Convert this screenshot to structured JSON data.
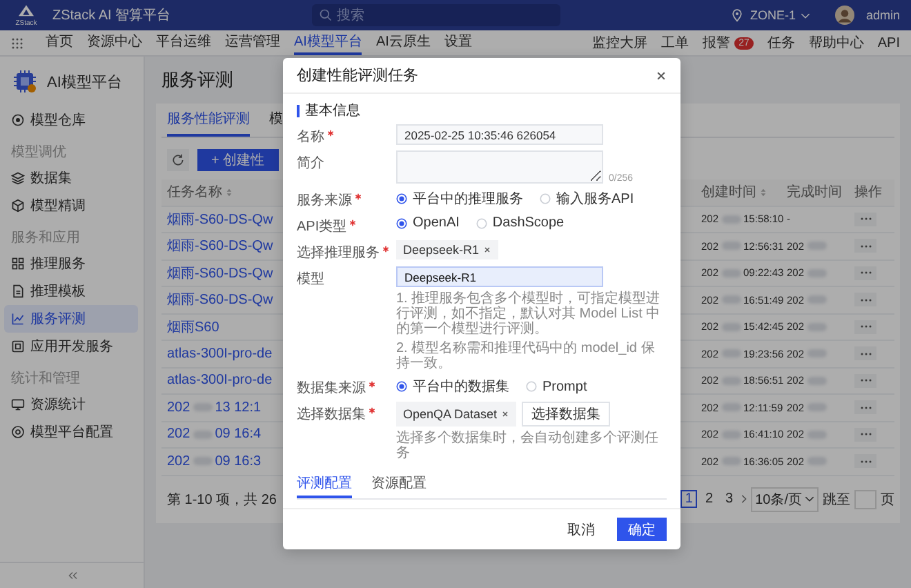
{
  "header": {
    "logo_text": "ZStack",
    "app_name": "ZStack AI 智算平台",
    "search_placeholder": "搜索",
    "zone": "ZONE-1",
    "user": "admin"
  },
  "nav": {
    "items": [
      {
        "label": "首页",
        "selected": false
      },
      {
        "label": "资源中心",
        "selected": false
      },
      {
        "label": "平台运维",
        "selected": false
      },
      {
        "label": "运营管理",
        "selected": false
      },
      {
        "label": "AI模型平台",
        "selected": true
      },
      {
        "label": "AI云原生",
        "selected": false
      },
      {
        "label": "设置",
        "selected": false
      }
    ],
    "right": [
      {
        "label": "监控大屏"
      },
      {
        "label": "工单"
      },
      {
        "label": "报警",
        "badge": "27"
      },
      {
        "label": "任务"
      },
      {
        "label": "帮助中心"
      },
      {
        "label": "API"
      }
    ]
  },
  "sidebar": {
    "title": "AI模型平台",
    "groups": [
      {
        "items": [
          {
            "label": "模型仓库",
            "selected": false
          }
        ]
      },
      {
        "heading": "模型调优",
        "items": [
          {
            "label": "数据集",
            "selected": false
          },
          {
            "label": "模型精调",
            "selected": false
          }
        ]
      },
      {
        "heading": "服务和应用",
        "items": [
          {
            "label": "推理服务",
            "selected": false
          },
          {
            "label": "推理模板",
            "selected": false
          },
          {
            "label": "服务评测",
            "selected": true
          },
          {
            "label": "应用开发服务",
            "selected": false
          }
        ]
      },
      {
        "heading": "统计和管理",
        "items": [
          {
            "label": "资源统计",
            "selected": false
          },
          {
            "label": "模型平台配置",
            "selected": false
          }
        ]
      }
    ]
  },
  "page": {
    "title": "服务评测",
    "tabs": [
      {
        "label": "服务性能评测",
        "selected": true
      },
      {
        "label": "模",
        "selected": false
      }
    ],
    "create_button": "+ 创建性"
  },
  "table": {
    "columns": [
      {
        "label": "任务名称",
        "sortable": true
      },
      {
        "label": "创建时间",
        "sortable": true
      },
      {
        "label": "完成时间",
        "sortable": false
      },
      {
        "label": "操作",
        "sortable": false
      }
    ],
    "rows": [
      {
        "name": "烟雨-S60-DS-Qw",
        "created": "202",
        "created_tail": "15:58:10",
        "completed": "-",
        "completed_redacted": false
      },
      {
        "name": "烟雨-S60-DS-Qw",
        "created": "202",
        "created_tail": "12:56:31",
        "completed": "202",
        "completed_redacted": true
      },
      {
        "name": "烟雨-S60-DS-Qw",
        "created": "202",
        "created_tail": "09:22:43",
        "completed": "202",
        "completed_redacted": true
      },
      {
        "name": "烟雨-S60-DS-Qw",
        "created": "202",
        "created_tail": "16:51:49",
        "completed": "202",
        "completed_redacted": true
      },
      {
        "name": "烟雨S60",
        "created": "202",
        "created_tail": "15:42:45",
        "completed": "202",
        "completed_redacted": true
      },
      {
        "name": "atlas-300I-pro-de",
        "created": "202",
        "created_tail": "19:23:56",
        "completed": "202",
        "completed_redacted": true
      },
      {
        "name": "atlas-300I-pro-de",
        "created": "202",
        "created_tail": "18:56:51",
        "completed": "202",
        "completed_redacted": true
      },
      {
        "name": "202",
        "name_tail": "13 12:1",
        "created": "202",
        "created_tail": "12:11:59",
        "completed": "202",
        "completed_redacted": true
      },
      {
        "name": "202",
        "name_tail": "09 16:4",
        "created": "202",
        "created_tail": "16:41:10",
        "completed": "202",
        "completed_redacted": true
      },
      {
        "name": "202",
        "name_tail": "09 16:3",
        "created": "202",
        "created_tail": "16:36:05",
        "completed": "202",
        "completed_redacted": true
      }
    ]
  },
  "pagination": {
    "summary": "第 1-10 项，共 26",
    "pages": [
      {
        "label": "1",
        "selected": true
      },
      {
        "label": "2",
        "selected": false
      },
      {
        "label": "3",
        "selected": false
      }
    ],
    "page_size": "10条/页",
    "jump_label": "跳至",
    "jump_suffix": "页"
  },
  "dialog": {
    "title": "创建性能评测任务",
    "section": "基本信息",
    "fields": [
      {
        "kind": "text",
        "label": "名称",
        "required": true,
        "value": "2025-02-25 10:35:46 626054",
        "focused": false
      },
      {
        "kind": "textarea",
        "label": "简介",
        "required": false,
        "counter": "0/256"
      },
      {
        "kind": "radio",
        "label": "服务来源",
        "required": true,
        "options": [
          {
            "label": "平台中的推理服务",
            "selected": true
          },
          {
            "label": "输入服务API",
            "selected": false
          }
        ]
      },
      {
        "kind": "radio",
        "label": "API类型",
        "required": true,
        "options": [
          {
            "label": "OpenAI",
            "selected": true
          },
          {
            "label": "DashScope",
            "selected": false
          }
        ]
      },
      {
        "kind": "tags",
        "label": "选择推理服务",
        "required": true,
        "tags": [
          "Deepseek-R1"
        ]
      },
      {
        "kind": "text",
        "label": "模型",
        "required": false,
        "value": "Deepseek-R1",
        "focused": true,
        "help": [
          "1. 推理服务包含多个模型时，可指定模型进行评测，如不指定，默认对其 Model List 中的第一个模型进行评测。",
          "2. 模型名称需和推理代码中的 model_id 保持一致。"
        ]
      },
      {
        "kind": "radio",
        "label": "数据集来源",
        "required": true,
        "options": [
          {
            "label": "平台中的数据集",
            "selected": true
          },
          {
            "label": "Prompt",
            "selected": false
          }
        ]
      },
      {
        "kind": "tags",
        "label": "选择数据集",
        "required": true,
        "tags": [
          "OpenQA Dataset"
        ],
        "button": "选择数据集",
        "help": [
          "选择多个数据集时，会自动创建多个评测任务"
        ]
      }
    ],
    "tabs": [
      {
        "label": "评测配置",
        "selected": true
      },
      {
        "label": "资源配置",
        "selected": false
      }
    ],
    "buttons": [
      {
        "label": "取消",
        "kind": "secondary"
      },
      {
        "label": "确定",
        "kind": "primary"
      }
    ]
  }
}
